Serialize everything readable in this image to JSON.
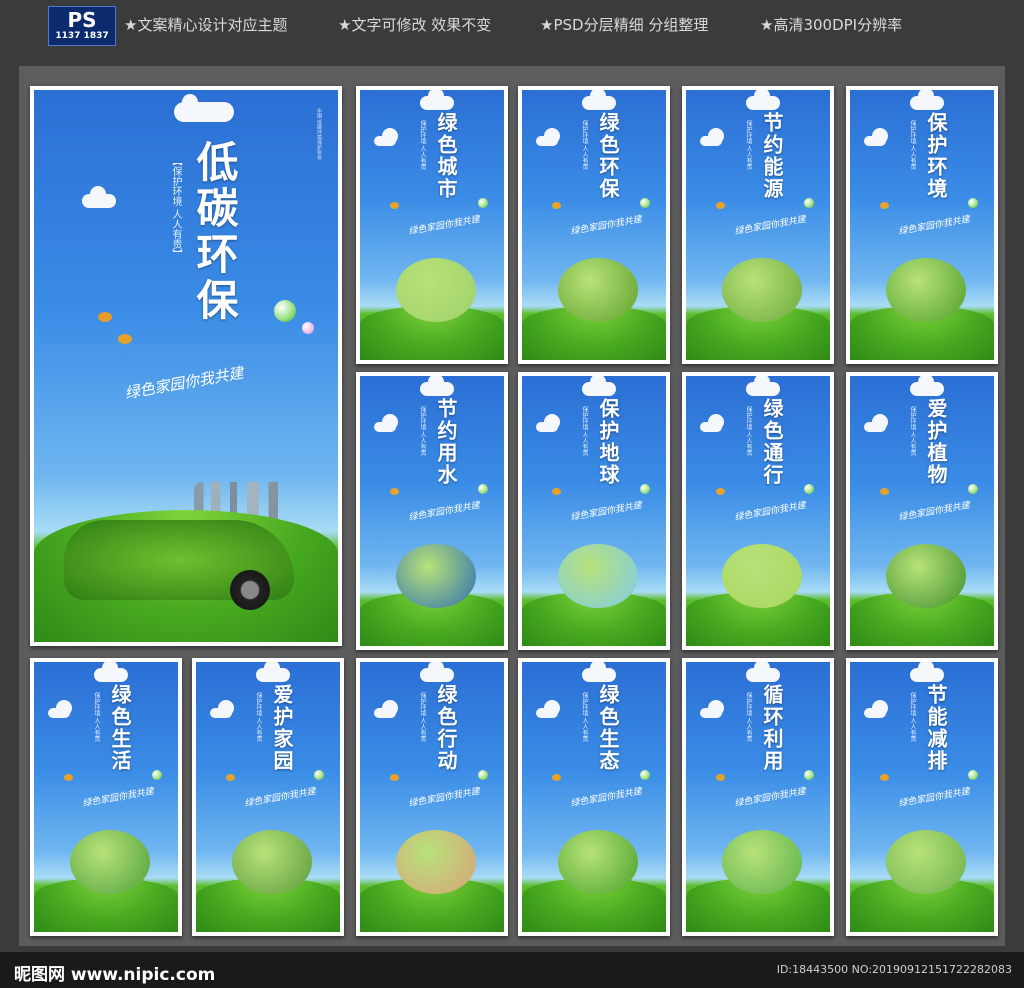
{
  "header": {
    "logo_main": "PS",
    "logo_number": "1137 1837",
    "features": [
      "★文案精心设计对应主题",
      "★文字可修改 效果不变",
      "★PSD分层精细 分组整理",
      "★高清300DPI分辨率"
    ]
  },
  "main_poster": {
    "title": "低碳环保",
    "subtitle": "【保护环境 人人有责】",
    "slogan": "绿色家园你我共建",
    "org_line": "中国·低碳环境保护协会"
  },
  "posters": [
    {
      "title": "绿色城市",
      "subtitle": "保护环境 人人有责",
      "slogan": "绿色家园你我共建"
    },
    {
      "title": "绿色环保",
      "subtitle": "保护环境 人人有责",
      "slogan": "绿色家园你我共建"
    },
    {
      "title": "节约能源",
      "subtitle": "保护环境 人人有责",
      "slogan": "绿色家园你我共建"
    },
    {
      "title": "保护环境",
      "subtitle": "保护环境 人人有责",
      "slogan": "绿色家园你我共建"
    },
    {
      "title": "节约用水",
      "subtitle": "保护环境 人人有责",
      "slogan": "绿色家园你我共建"
    },
    {
      "title": "保护地球",
      "subtitle": "保护环境 人人有责",
      "slogan": "绿色家园你我共建"
    },
    {
      "title": "绿色通行",
      "subtitle": "保护环境 人人有责",
      "slogan": "绿色家园你我共建"
    },
    {
      "title": "爱护植物",
      "subtitle": "保护环境 人人有责",
      "slogan": "绿色家园你我共建"
    },
    {
      "title": "绿色生活",
      "subtitle": "保护环境 人人有责",
      "slogan": "绿色家园你我共建"
    },
    {
      "title": "爱护家园",
      "subtitle": "保护环境 人人有责",
      "slogan": "绿色家园你我共建"
    },
    {
      "title": "绿色行动",
      "subtitle": "保护环境 人人有责",
      "slogan": "绿色家园你我共建"
    },
    {
      "title": "绿色生态",
      "subtitle": "保护环境 人人有责",
      "slogan": "绿色家园你我共建"
    },
    {
      "title": "循环利用",
      "subtitle": "保护环境 人人有责",
      "slogan": "绿色家园你我共建"
    },
    {
      "title": "节能减排",
      "subtitle": "保护环境 人人有责",
      "slogan": "绿色家园你我共建"
    }
  ],
  "footer": {
    "site": "昵图网 www.nipic.com",
    "id_text": "ID:18443500 NO:20190912151722282083"
  },
  "colors": {
    "sky_top": "#2b6fd4",
    "grass": "#47a920",
    "frame": "#ffffff",
    "background": "#3b3b3b"
  }
}
